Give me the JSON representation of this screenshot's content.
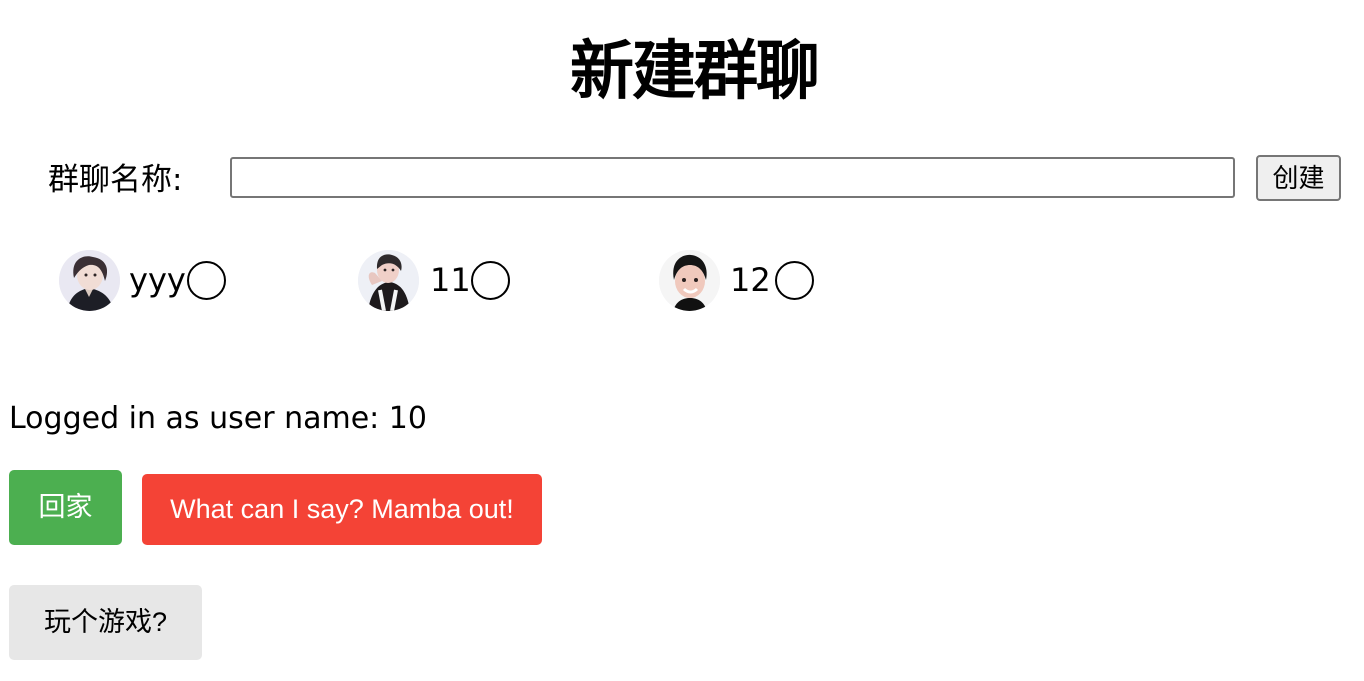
{
  "page": {
    "title": "新建群聊"
  },
  "form": {
    "group_name_label": "群聊名称:",
    "group_name_value": "",
    "group_name_placeholder": "",
    "create_label": "创建"
  },
  "members": [
    {
      "name": "yyy",
      "selected": false,
      "avatar_icon": "profile-photo-icon"
    },
    {
      "name": "11",
      "selected": false,
      "avatar_icon": "profile-photo-icon"
    },
    {
      "name": "12",
      "selected": false,
      "avatar_icon": "profile-photo-icon"
    }
  ],
  "status": {
    "login_text": "Logged in as user name: 10"
  },
  "actions": {
    "home_label": "回家",
    "mamba_label": "What can I say? Mamba out!",
    "game_label": "玩个游戏?"
  },
  "colors": {
    "home_button": "#4caf50",
    "mamba_button": "#f44336",
    "game_button": "#e7e7e7"
  }
}
